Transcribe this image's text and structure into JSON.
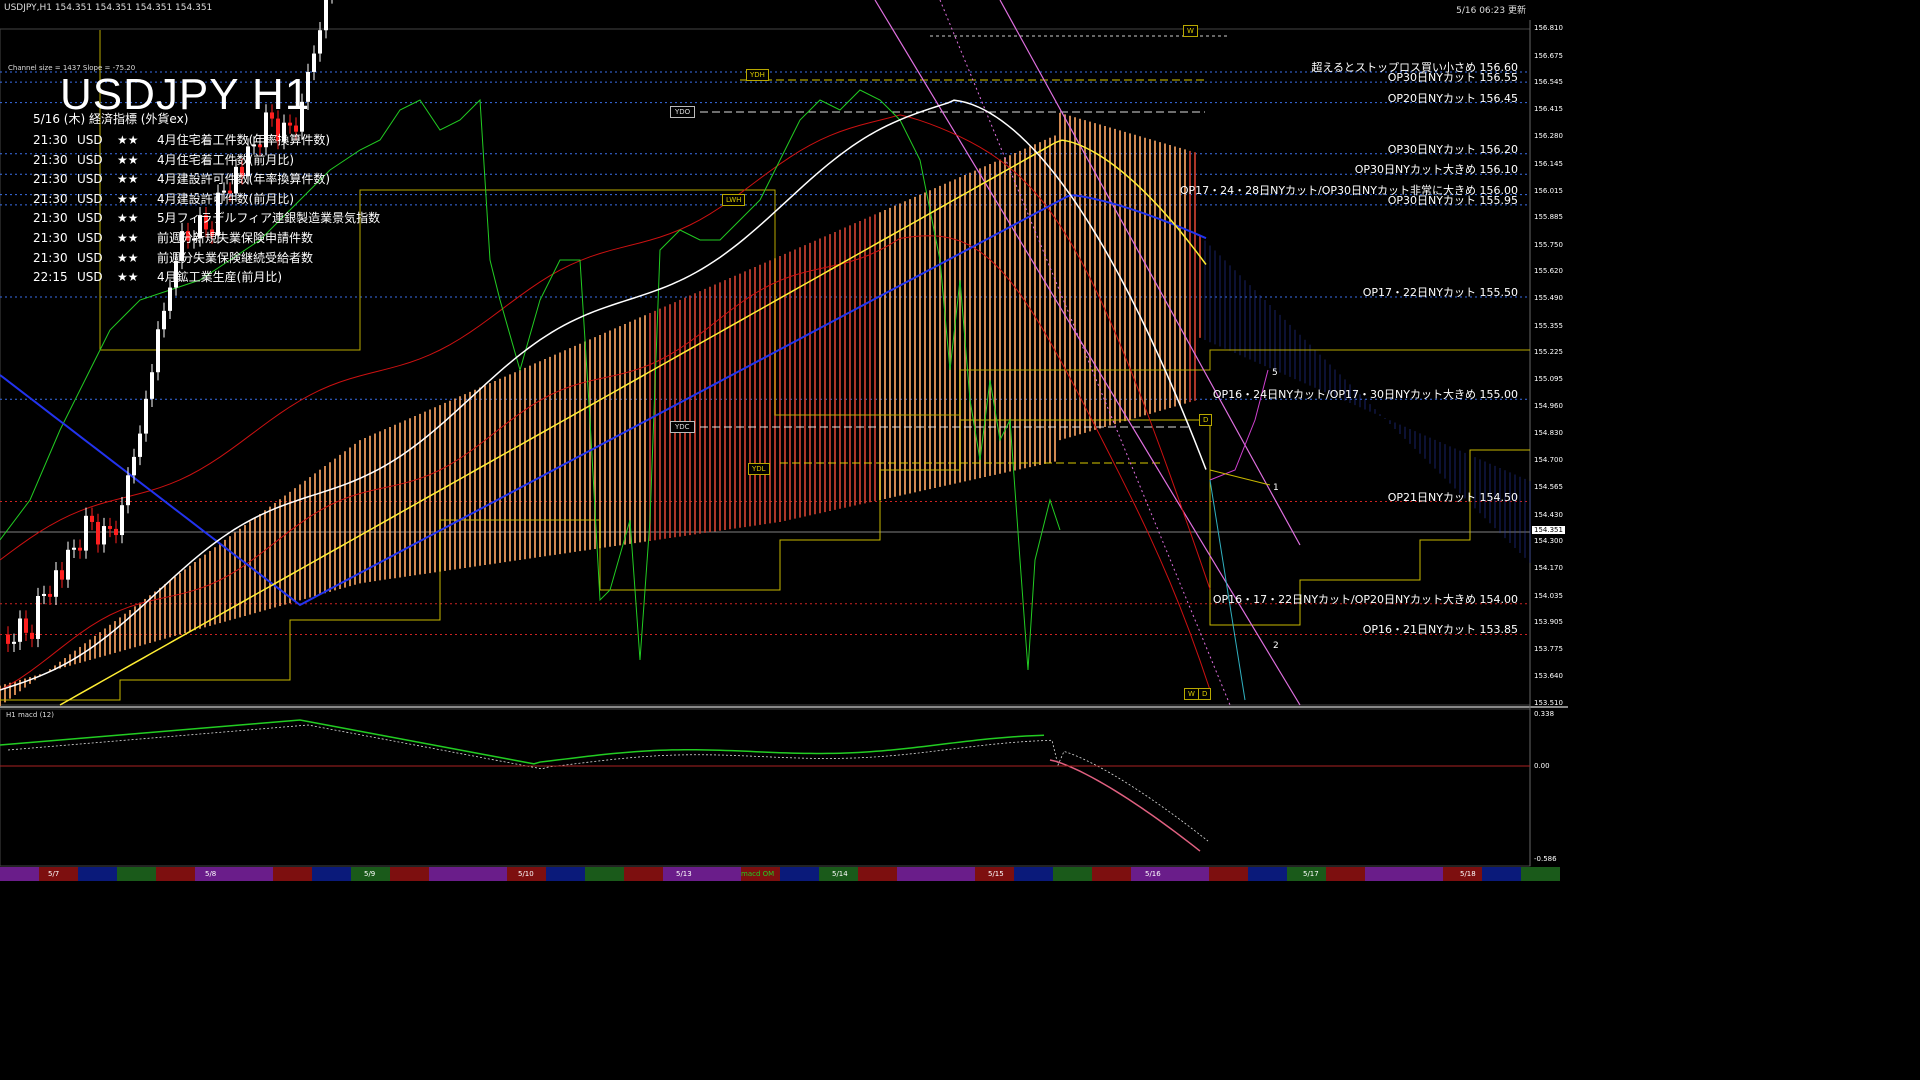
{
  "header": {
    "symbol_info": "USDJPY,H1  154.351 154.351 154.351 154.351",
    "updated": "5/16 06:23 更新"
  },
  "title": "USDJPY H1",
  "channel_info": "Channel size = 1437 Slope = -75.20",
  "events": {
    "heading": "5/16 (木) 経済指標 (外貨ex)",
    "items": [
      {
        "time": "21:30",
        "ccy": "USD",
        "stars": "★★",
        "name": "4月住宅着工件数(年率換算件数)"
      },
      {
        "time": "21:30",
        "ccy": "USD",
        "stars": "★★",
        "name": "4月住宅着工件数(前月比)"
      },
      {
        "time": "21:30",
        "ccy": "USD",
        "stars": "★★",
        "name": "4月建設許可件数(年率換算件数)"
      },
      {
        "time": "21:30",
        "ccy": "USD",
        "stars": "★★",
        "name": "4月建設許可件数(前月比)"
      },
      {
        "time": "21:30",
        "ccy": "USD",
        "stars": "★★",
        "name": "5月フィラデルフィア連銀製造業景気指数"
      },
      {
        "time": "21:30",
        "ccy": "USD",
        "stars": "★★",
        "name": "前週分新規失業保険申請件数"
      },
      {
        "time": "21:30",
        "ccy": "USD",
        "stars": "★★",
        "name": "前週分失業保険継続受給者数"
      },
      {
        "time": "22:15",
        "ccy": "USD",
        "stars": "★★",
        "name": "4月鉱工業生産(前月比)"
      }
    ]
  },
  "annotations": [
    {
      "text": "超えるとストップロス買い小さめ 156.60",
      "price": 156.6
    },
    {
      "text": "OP30日NYカット 156.55",
      "price": 156.55
    },
    {
      "text": "OP20日NYカット 156.45",
      "price": 156.45
    },
    {
      "text": "OP30日NYカット 156.20",
      "price": 156.2
    },
    {
      "text": "OP30日NYカット大きめ 156.10",
      "price": 156.1
    },
    {
      "text": "OP17・24・28日NYカット/OP30日NYカット非常に大きめ 156.00",
      "price": 156.0
    },
    {
      "text": "OP30日NYカット 155.95",
      "price": 155.95
    },
    {
      "text": "OP17・22日NYカット 155.50",
      "price": 155.5
    },
    {
      "text": "OP16・24日NYカット/OP17・30日NYカット大きめ 155.00",
      "price": 155.0
    },
    {
      "text": "OP21日NYカット 154.50",
      "price": 154.5
    },
    {
      "text": "OP16・17・22日NYカット/OP20日NYカット大きめ 154.00",
      "price": 154.0
    },
    {
      "text": "OP16・21日NYカット 153.85",
      "price": 153.85
    }
  ],
  "price_axis": [
    "156.810",
    "156.675",
    "156.545",
    "156.415",
    "156.280",
    "156.145",
    "156.015",
    "155.885",
    "155.750",
    "155.620",
    "155.490",
    "155.355",
    "155.225",
    "155.095",
    "154.960",
    "154.830",
    "154.700",
    "154.565",
    "154.430",
    "154.300",
    "154.170",
    "154.035",
    "153.905",
    "153.775",
    "153.640",
    "153.510"
  ],
  "current_price": "154.351",
  "macd_axis": [
    "0.338",
    "0.00",
    "-0.586"
  ],
  "macd_label": "H1  macd (12)",
  "level_boxes": {
    "ydh": "YDH",
    "ydo": "YDO",
    "lwh": "LWH",
    "ydc": "YDC",
    "ydl": "YDL",
    "w_top": "W",
    "d_mid": "D",
    "w_bot": "W",
    "d_bot": "D"
  },
  "wave_labels": [
    "5",
    "1",
    "2"
  ],
  "dates": [
    "5/7",
    "5/8",
    "5/9",
    "5/10",
    "5/13",
    "5/14",
    "5/15",
    "5/16",
    "5/17",
    "5/18"
  ],
  "bottom_badge": "macd OM",
  "colors": {
    "bg": "#000000",
    "up": "#ffffff",
    "down": "#ff2020",
    "kumo_up": "#f4a060",
    "kumo_down": "#c84030",
    "sma_white": "#ffffff",
    "sma_yellow": "#ffee33",
    "sma_blue": "#2233ee",
    "chikou": "#22cc22",
    "bb": "#cc1111",
    "level_yellow": "#d8c800"
  }
}
